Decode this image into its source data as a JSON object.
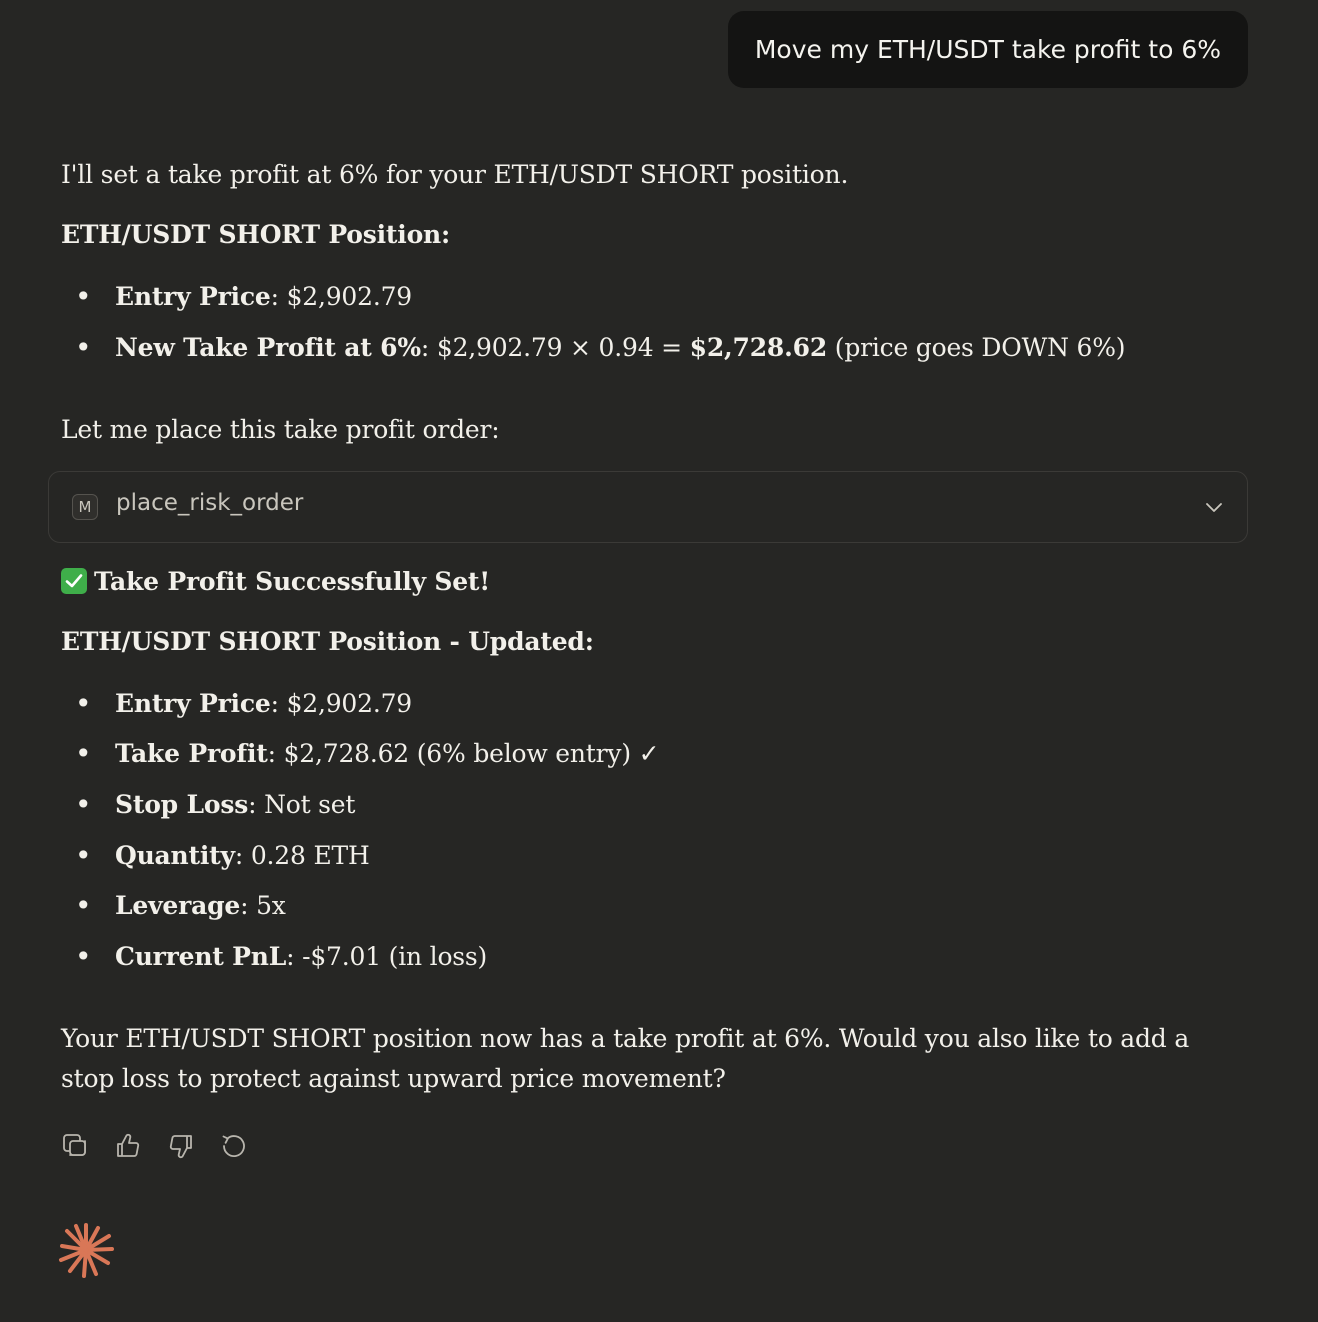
{
  "user_message": "Move my ETH/USDT take profit to 6%",
  "reply": {
    "intro": "I'll set a take profit at 6% for your ETH/USDT SHORT position.",
    "position_heading": "ETH/USDT SHORT Position:",
    "position_items": [
      {
        "label": "Entry Price",
        "sep": ": ",
        "value": "$2,902.79"
      },
      {
        "label": "New Take Profit at 6%",
        "sep": ": ",
        "value_pre": "$2,902.79 × 0.94 = ",
        "value_bold": "$2,728.62",
        "value_post": " (price goes DOWN 6%)"
      }
    ],
    "place_text": "Let me place this take profit order:",
    "tool": {
      "badge": "M",
      "name": "place_risk_order",
      "icon": "chevron-down-icon"
    },
    "success_icon": "check-box-icon",
    "success_title": "Take Profit Successfully Set!",
    "updated_heading": "ETH/USDT SHORT Position - Updated:",
    "updated_items": [
      {
        "label": "Entry Price",
        "sep": ": ",
        "value": "$2,902.79"
      },
      {
        "label": "Take Profit",
        "sep": ": ",
        "value": "$2,728.62 (6% below entry) ✓"
      },
      {
        "label": "Stop Loss",
        "sep": ": ",
        "value": "Not set"
      },
      {
        "label": "Quantity",
        "sep": ": ",
        "value": "0.28 ETH"
      },
      {
        "label": "Leverage",
        "sep": ": ",
        "value": "5x"
      },
      {
        "label": "Current PnL",
        "sep": ": ",
        "value": "-$7.01 (in loss)"
      }
    ],
    "closing_line1": "Your ETH/USDT SHORT position now has a take profit at 6%. Would you also like to add a",
    "closing_line2": "stop loss to protect against upward price movement?"
  },
  "actions": [
    {
      "icon": "copy-icon"
    },
    {
      "icon": "thumbs-up-icon"
    },
    {
      "icon": "thumbs-down-icon"
    },
    {
      "icon": "retry-icon"
    }
  ],
  "logo_icon": "claude-spark-icon",
  "colors": {
    "background": "#262624",
    "user_bubble": "#141413",
    "text": "#f2f0ea",
    "muted": "#c9c6bd",
    "success": "#3fae4a",
    "logo": "#d97757"
  }
}
